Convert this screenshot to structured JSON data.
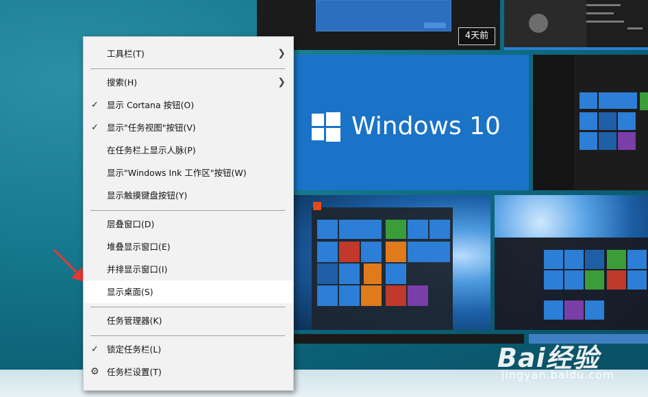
{
  "thumbnails": {
    "top_left_badge": "4天前",
    "windows_logo_text": "Windows 10"
  },
  "context_menu": {
    "items": [
      {
        "label": "工具栏(T)",
        "checked": false,
        "submenu": true
      },
      {
        "label": "搜索(H)",
        "checked": false,
        "submenu": true
      },
      {
        "label": "显示 Cortana 按钮(O)",
        "checked": true,
        "submenu": false
      },
      {
        "label": "显示\"任务视图\"按钮(V)",
        "checked": true,
        "submenu": false
      },
      {
        "label": "在任务栏上显示人脉(P)",
        "checked": false,
        "submenu": false
      },
      {
        "label": "显示\"Windows Ink 工作区\"按钮(W)",
        "checked": false,
        "submenu": false
      },
      {
        "label": "显示触摸键盘按钮(Y)",
        "checked": false,
        "submenu": false
      },
      {
        "label": "层叠窗口(D)",
        "checked": false,
        "submenu": false
      },
      {
        "label": "堆叠显示窗口(E)",
        "checked": false,
        "submenu": false
      },
      {
        "label": "并排显示窗口(I)",
        "checked": false,
        "submenu": false
      },
      {
        "label": "显示桌面(S)",
        "checked": false,
        "submenu": false,
        "highlighted": true
      },
      {
        "label": "任务管理器(K)",
        "checked": false,
        "submenu": false
      },
      {
        "label": "锁定任务栏(L)",
        "checked": true,
        "submenu": false
      },
      {
        "label": "任务栏设置(T)",
        "checked": false,
        "submenu": false,
        "icon": "gear-icon"
      }
    ]
  },
  "watermark": {
    "brand": "Bai经验",
    "url": "jingyan.baidu.com"
  },
  "colors": {
    "desktop": "#0f6f85",
    "menu_bg": "#f2f2f2",
    "highlight": "#ffffff",
    "arrow": "#e53935",
    "win_blue": "#1a73c7"
  }
}
